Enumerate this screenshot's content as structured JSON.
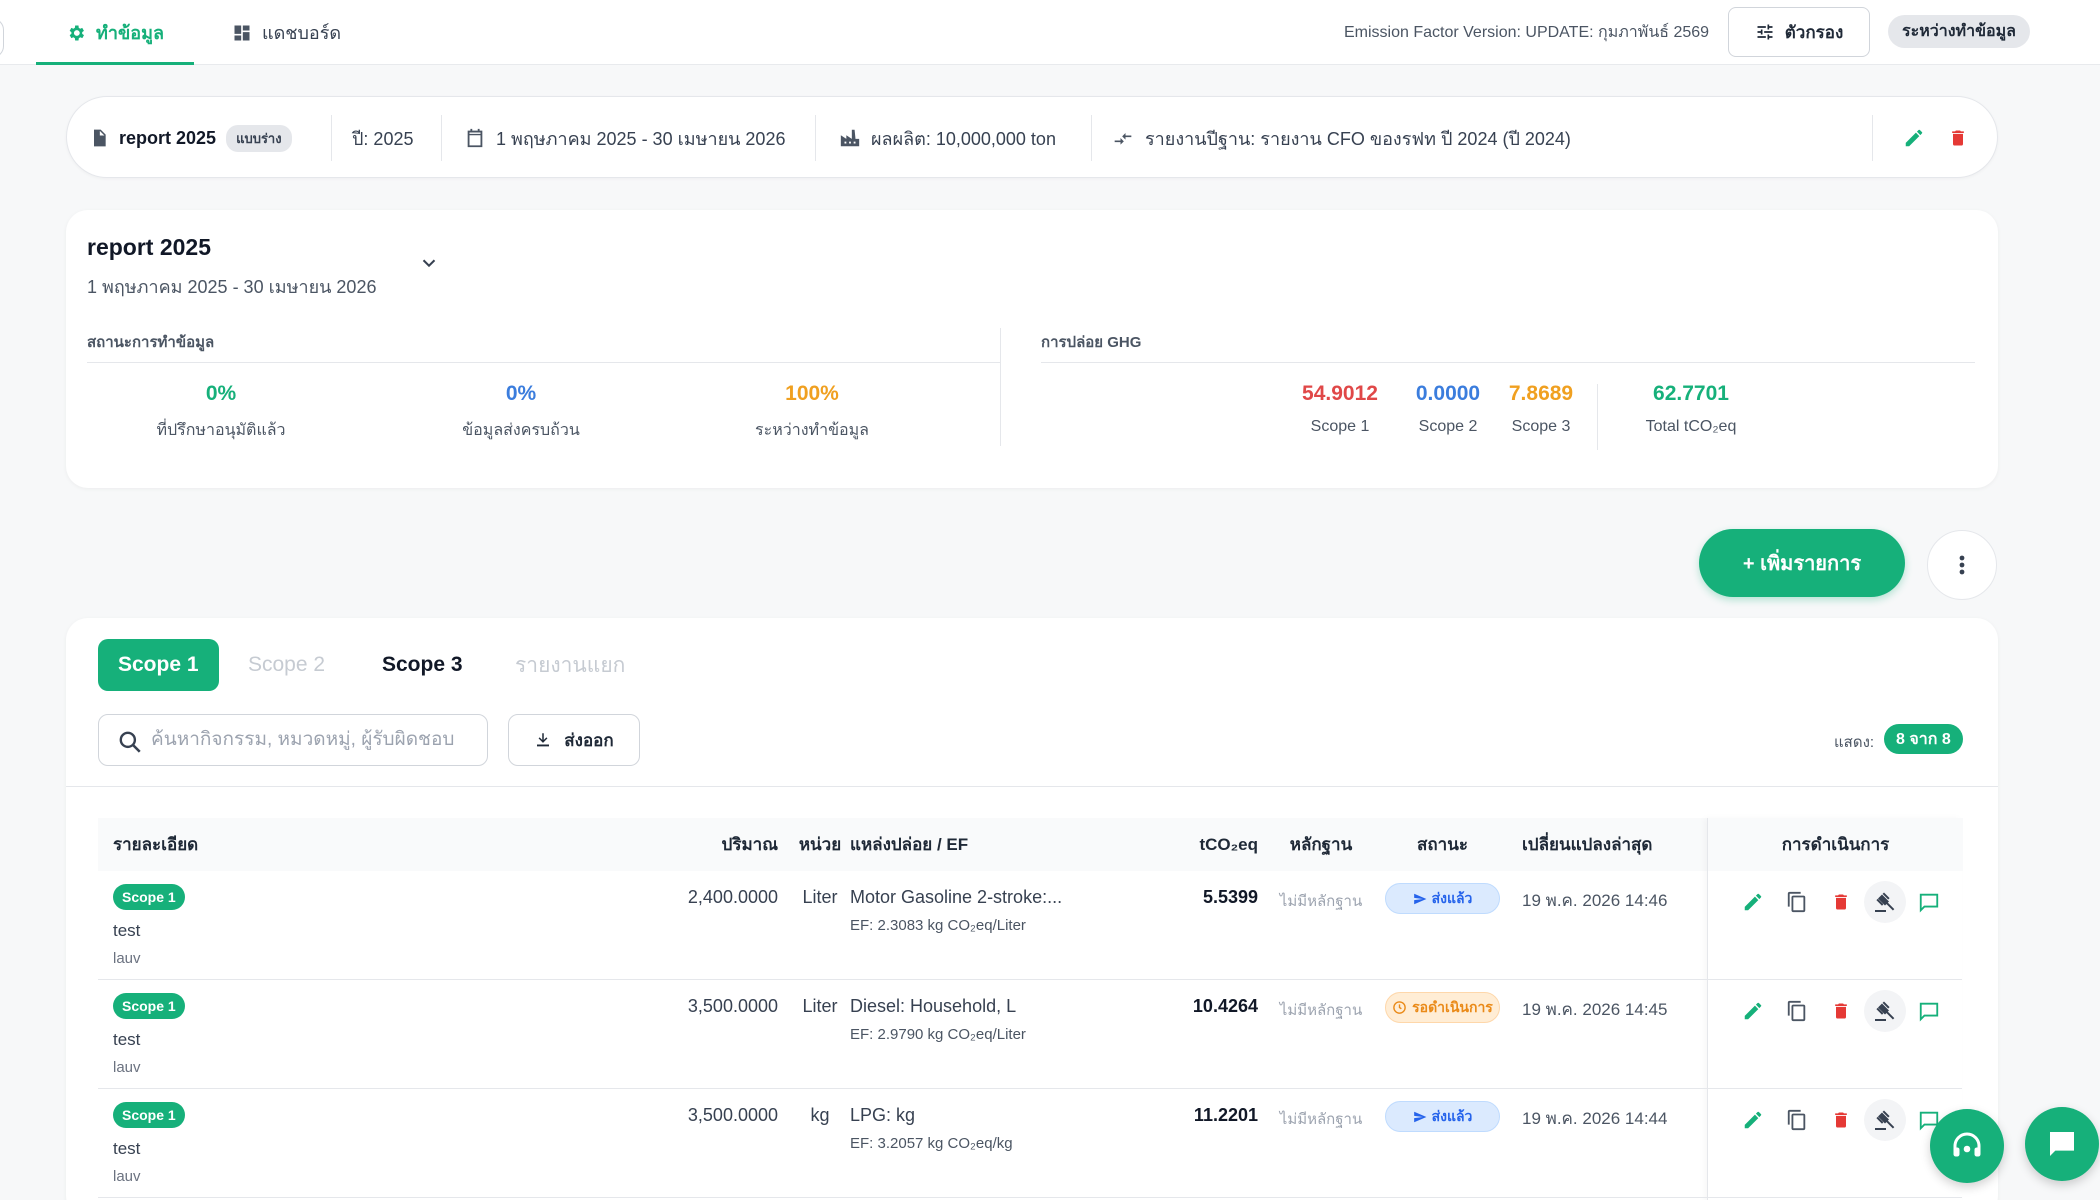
{
  "nav": {
    "tabs": [
      {
        "label": "ทำข้อมูล",
        "icon": "gear-icon",
        "active": true
      },
      {
        "label": "แดชบอร์ด",
        "icon": "dashboard-icon",
        "active": false
      }
    ],
    "ef_version": "Emission Factor Version: UPDATE: กุมภาพันธ์ 2569",
    "filter_label": "ตัวกรอง",
    "status_chip": "ระหว่างทำข้อมูล"
  },
  "infobar": {
    "report_name": "report 2025",
    "draft_badge": "แบบร่าง",
    "year": "ปี: 2025",
    "period": "1 พฤษภาคม 2025 - 30 เมษายน 2026",
    "production": "ผลผลิต: 10,000,000 ton",
    "baseline": "รายงานปีฐาน: รายงาน CFO ของรฟท ปี 2024 (ปี 2024)"
  },
  "report": {
    "title": "report 2025",
    "period": "1 พฤษภาคม 2025 - 30 เมษายน 2026",
    "status_section": "สถานะการทำข้อมูล",
    "ghg_section": "การปล่อย GHG",
    "status_stats": [
      {
        "value": "0%",
        "label": "ที่ปรึกษาอนุมัติแล้ว",
        "color": "#16b07a"
      },
      {
        "value": "0%",
        "label": "ข้อมูลส่งครบถ้วน",
        "color": "#3b7ddd"
      },
      {
        "value": "100%",
        "label": "ระหว่างทำข้อมูล",
        "color": "#f0a020"
      }
    ],
    "ghg_stats": [
      {
        "value": "54.9012",
        "label": "Scope 1",
        "color": "#e04848"
      },
      {
        "value": "0.0000",
        "label": "Scope 2",
        "color": "#3b7ddd"
      },
      {
        "value": "7.8689",
        "label": "Scope 3",
        "color": "#f0a020"
      },
      {
        "value": "62.7701",
        "label": "Total tCO₂eq",
        "color": "#16b07a"
      }
    ]
  },
  "add_button": "+ เพิ่มรายการ",
  "tabs": {
    "scope1": "Scope 1",
    "scope2": "Scope 2",
    "scope3": "Scope 3",
    "separate": "รายงานแยก"
  },
  "toolbar": {
    "search_placeholder": "ค้นหากิจกรรม, หมวดหมู่, ผู้รับผิดชอบ",
    "export_label": "ส่งออก",
    "showing_label": "แสดง:",
    "showing_value": "8 จาก 8"
  },
  "table": {
    "headers": {
      "detail": "รายละเอียด",
      "qty": "ปริมาณ",
      "unit": "หน่วย",
      "source": "แหล่งปล่อย / EF",
      "tco2": "tCO₂eq",
      "evidence": "หลักฐาน",
      "status": "สถานะ",
      "updated": "เปลี่ยนแปลงล่าสุด",
      "actions": "การดำเนินการ"
    },
    "rows": [
      {
        "scope": "Scope 1",
        "name": "test",
        "owner": "lauv",
        "qty": "2,400.0000",
        "unit": "Liter",
        "source": "Motor Gasoline 2-stroke:...",
        "ef": "EF: 2.3083 kg CO₂eq/Liter",
        "tco2": "5.5399",
        "evidence": "ไม่มีหลักฐาน",
        "status": "ส่งแล้ว",
        "status_type": "sent",
        "updated": "19 พ.ค. 2026 14:46"
      },
      {
        "scope": "Scope 1",
        "name": "test",
        "owner": "lauv",
        "qty": "3,500.0000",
        "unit": "Liter",
        "source": "Diesel: Household, L",
        "ef": "EF: 2.9790 kg CO₂eq/Liter",
        "tco2": "10.4264",
        "evidence": "ไม่มีหลักฐาน",
        "status": "รอดำเนินการ",
        "status_type": "wait",
        "updated": "19 พ.ค. 2026 14:45"
      },
      {
        "scope": "Scope 1",
        "name": "test",
        "owner": "lauv",
        "qty": "3,500.0000",
        "unit": "kg",
        "source": "LPG: kg",
        "ef": "EF: 3.2057 kg CO₂eq/kg",
        "tco2": "11.2201",
        "evidence": "ไม่มีหลักฐาน",
        "status": "ส่งแล้ว",
        "status_type": "sent",
        "updated": "19 พ.ค. 2026 14:44"
      }
    ]
  },
  "colors": {
    "accent": "#16b07a",
    "danger": "#e53935"
  }
}
